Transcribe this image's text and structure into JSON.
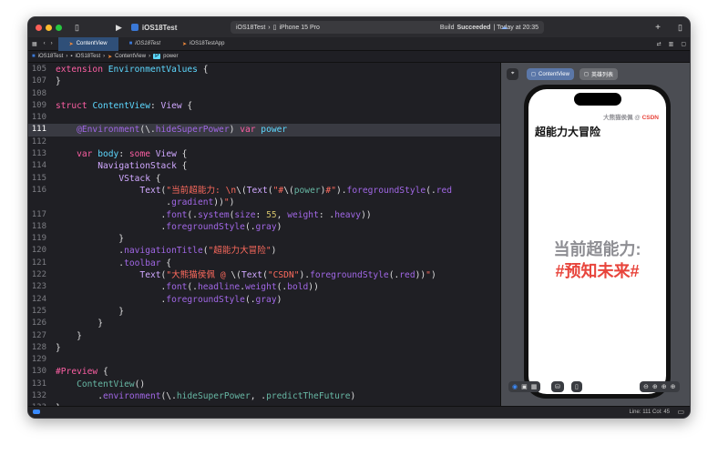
{
  "titlebar": {
    "project": "iOS18Test",
    "scheme": "iOS18Test",
    "device": "iPhone 15 Pro",
    "build_status_prefix": "Build",
    "build_status": "Succeeded",
    "build_time": "| Today at 20:35"
  },
  "tabs": [
    {
      "label": "ContentView",
      "active": true
    },
    {
      "label": "iOS18Test",
      "active": false
    },
    {
      "label": "iOS18TestApp",
      "active": false
    }
  ],
  "breadcrumb": [
    "iOS18Test",
    "iOS18Test",
    "ContentView",
    "power"
  ],
  "code": [
    {
      "n": "105",
      "t": [
        [
          "kw",
          "extension "
        ],
        [
          "decl",
          "EnvironmentValues"
        ],
        [
          "plain",
          " {"
        ]
      ]
    },
    {
      "n": "107",
      "t": [
        [
          "plain",
          "}"
        ]
      ]
    },
    {
      "n": "108",
      "t": []
    },
    {
      "n": "109",
      "t": [
        [
          "kw",
          "struct "
        ],
        [
          "decl",
          "ContentView"
        ],
        [
          "plain",
          ": "
        ],
        [
          "type",
          "View"
        ],
        [
          "plain",
          " {"
        ]
      ]
    },
    {
      "n": "110",
      "t": []
    },
    {
      "n": "111",
      "cur": true,
      "t": [
        [
          "plain",
          "    "
        ],
        [
          "fn",
          "@Environment"
        ],
        [
          "plain",
          "(\\."
        ],
        [
          "fn",
          "hideSuperPower"
        ],
        [
          "plain",
          ") "
        ],
        [
          "kw",
          "var "
        ],
        [
          "decl",
          "power"
        ]
      ]
    },
    {
      "n": "112",
      "t": []
    },
    {
      "n": "113",
      "t": [
        [
          "plain",
          "    "
        ],
        [
          "kw",
          "var "
        ],
        [
          "decl",
          "body"
        ],
        [
          "plain",
          ": "
        ],
        [
          "kw",
          "some "
        ],
        [
          "type",
          "View"
        ],
        [
          "plain",
          " {"
        ]
      ]
    },
    {
      "n": "114",
      "t": [
        [
          "plain",
          "        "
        ],
        [
          "type",
          "NavigationStack"
        ],
        [
          "plain",
          " {"
        ]
      ]
    },
    {
      "n": "115",
      "t": [
        [
          "plain",
          "            "
        ],
        [
          "type",
          "VStack"
        ],
        [
          "plain",
          " {"
        ]
      ]
    },
    {
      "n": "116",
      "t": [
        [
          "plain",
          "                "
        ],
        [
          "type",
          "Text"
        ],
        [
          "plain",
          "("
        ],
        [
          "str",
          "\"当前超能力: \\n"
        ],
        [
          "plain",
          "\\("
        ],
        [
          "type",
          "Text"
        ],
        [
          "plain",
          "("
        ],
        [
          "str",
          "\"#"
        ],
        [
          "plain",
          "\\("
        ],
        [
          "prop",
          "power"
        ],
        [
          "plain",
          ")"
        ],
        [
          "str",
          "#\""
        ],
        [
          "plain",
          ")."
        ],
        [
          "fn",
          "foregroundStyle"
        ],
        [
          "plain",
          "(."
        ],
        [
          "fn",
          "red"
        ]
      ]
    },
    {
      "n": "",
      "t": [
        [
          "plain",
          "                     ."
        ],
        [
          "fn",
          "gradient"
        ],
        [
          "plain",
          "))"
        ],
        [
          "str",
          "\""
        ],
        [
          "plain",
          ")"
        ]
      ]
    },
    {
      "n": "117",
      "t": [
        [
          "plain",
          "                    ."
        ],
        [
          "fn",
          "font"
        ],
        [
          "plain",
          "(."
        ],
        [
          "fn",
          "system"
        ],
        [
          "plain",
          "("
        ],
        [
          "fn",
          "size"
        ],
        [
          "plain",
          ": "
        ],
        [
          "num",
          "55"
        ],
        [
          "plain",
          ", "
        ],
        [
          "fn",
          "weight"
        ],
        [
          "plain",
          ": ."
        ],
        [
          "fn",
          "heavy"
        ],
        [
          "plain",
          "))"
        ]
      ]
    },
    {
      "n": "118",
      "t": [
        [
          "plain",
          "                    ."
        ],
        [
          "fn",
          "foregroundStyle"
        ],
        [
          "plain",
          "(."
        ],
        [
          "fn",
          "gray"
        ],
        [
          "plain",
          ")"
        ]
      ]
    },
    {
      "n": "119",
      "t": [
        [
          "plain",
          "            }"
        ]
      ]
    },
    {
      "n": "120",
      "t": [
        [
          "plain",
          "            ."
        ],
        [
          "fn",
          "navigationTitle"
        ],
        [
          "plain",
          "("
        ],
        [
          "str",
          "\"超能力大冒险\""
        ],
        [
          "plain",
          ")"
        ]
      ]
    },
    {
      "n": "121",
      "t": [
        [
          "plain",
          "            ."
        ],
        [
          "fn",
          "toolbar"
        ],
        [
          "plain",
          " {"
        ]
      ]
    },
    {
      "n": "122",
      "t": [
        [
          "plain",
          "                "
        ],
        [
          "type",
          "Text"
        ],
        [
          "plain",
          "("
        ],
        [
          "str",
          "\"大熊猫侯佩 @ "
        ],
        [
          "plain",
          "\\("
        ],
        [
          "type",
          "Text"
        ],
        [
          "plain",
          "("
        ],
        [
          "str",
          "\"CSDN\""
        ],
        [
          "plain",
          ")."
        ],
        [
          "fn",
          "foregroundStyle"
        ],
        [
          "plain",
          "(."
        ],
        [
          "fn",
          "red"
        ],
        [
          "plain",
          "))"
        ],
        [
          "str",
          "\""
        ],
        [
          "plain",
          ")"
        ]
      ]
    },
    {
      "n": "123",
      "t": [
        [
          "plain",
          "                    ."
        ],
        [
          "fn",
          "font"
        ],
        [
          "plain",
          "(."
        ],
        [
          "fn",
          "headline"
        ],
        [
          "plain",
          "."
        ],
        [
          "fn",
          "weight"
        ],
        [
          "plain",
          "(."
        ],
        [
          "fn",
          "bold"
        ],
        [
          "plain",
          "))"
        ]
      ]
    },
    {
      "n": "124",
      "t": [
        [
          "plain",
          "                    ."
        ],
        [
          "fn",
          "foregroundStyle"
        ],
        [
          "plain",
          "(."
        ],
        [
          "fn",
          "gray"
        ],
        [
          "plain",
          ")"
        ]
      ]
    },
    {
      "n": "125",
      "t": [
        [
          "plain",
          "            }"
        ]
      ]
    },
    {
      "n": "126",
      "t": [
        [
          "plain",
          "        }"
        ]
      ]
    },
    {
      "n": "127",
      "t": [
        [
          "plain",
          "    }"
        ]
      ]
    },
    {
      "n": "128",
      "t": [
        [
          "plain",
          "}"
        ]
      ]
    },
    {
      "n": "129",
      "t": []
    },
    {
      "n": "130",
      "t": [
        [
          "kw",
          "#Preview"
        ],
        [
          "plain",
          " {"
        ]
      ]
    },
    {
      "n": "131",
      "t": [
        [
          "plain",
          "    "
        ],
        [
          "prop",
          "ContentView"
        ],
        [
          "plain",
          "()"
        ]
      ]
    },
    {
      "n": "132",
      "t": [
        [
          "plain",
          "        ."
        ],
        [
          "fn",
          "environment"
        ],
        [
          "plain",
          "(\\."
        ],
        [
          "prop",
          "hideSuperPower"
        ],
        [
          "plain",
          ", ."
        ],
        [
          "prop",
          "predictTheFuture"
        ],
        [
          "plain",
          ")"
        ]
      ]
    },
    {
      "n": "133",
      "t": [
        [
          "plain",
          "}"
        ]
      ]
    }
  ],
  "preview": {
    "tabs": [
      "ContentView",
      "英雄列表"
    ],
    "toolbar_text_prefix": "大熊猫侯佩 @ ",
    "toolbar_text_accent": "CSDN",
    "nav_title": "超能力大冒险",
    "main_line1": "当前超能力:",
    "main_line2": "#预知未来#"
  },
  "statusbar": {
    "position": "Line: 111  Col: 45"
  },
  "colors": {
    "accent": "#2f4f78",
    "red": "#e8453c",
    "gray": "#8e8e93"
  }
}
